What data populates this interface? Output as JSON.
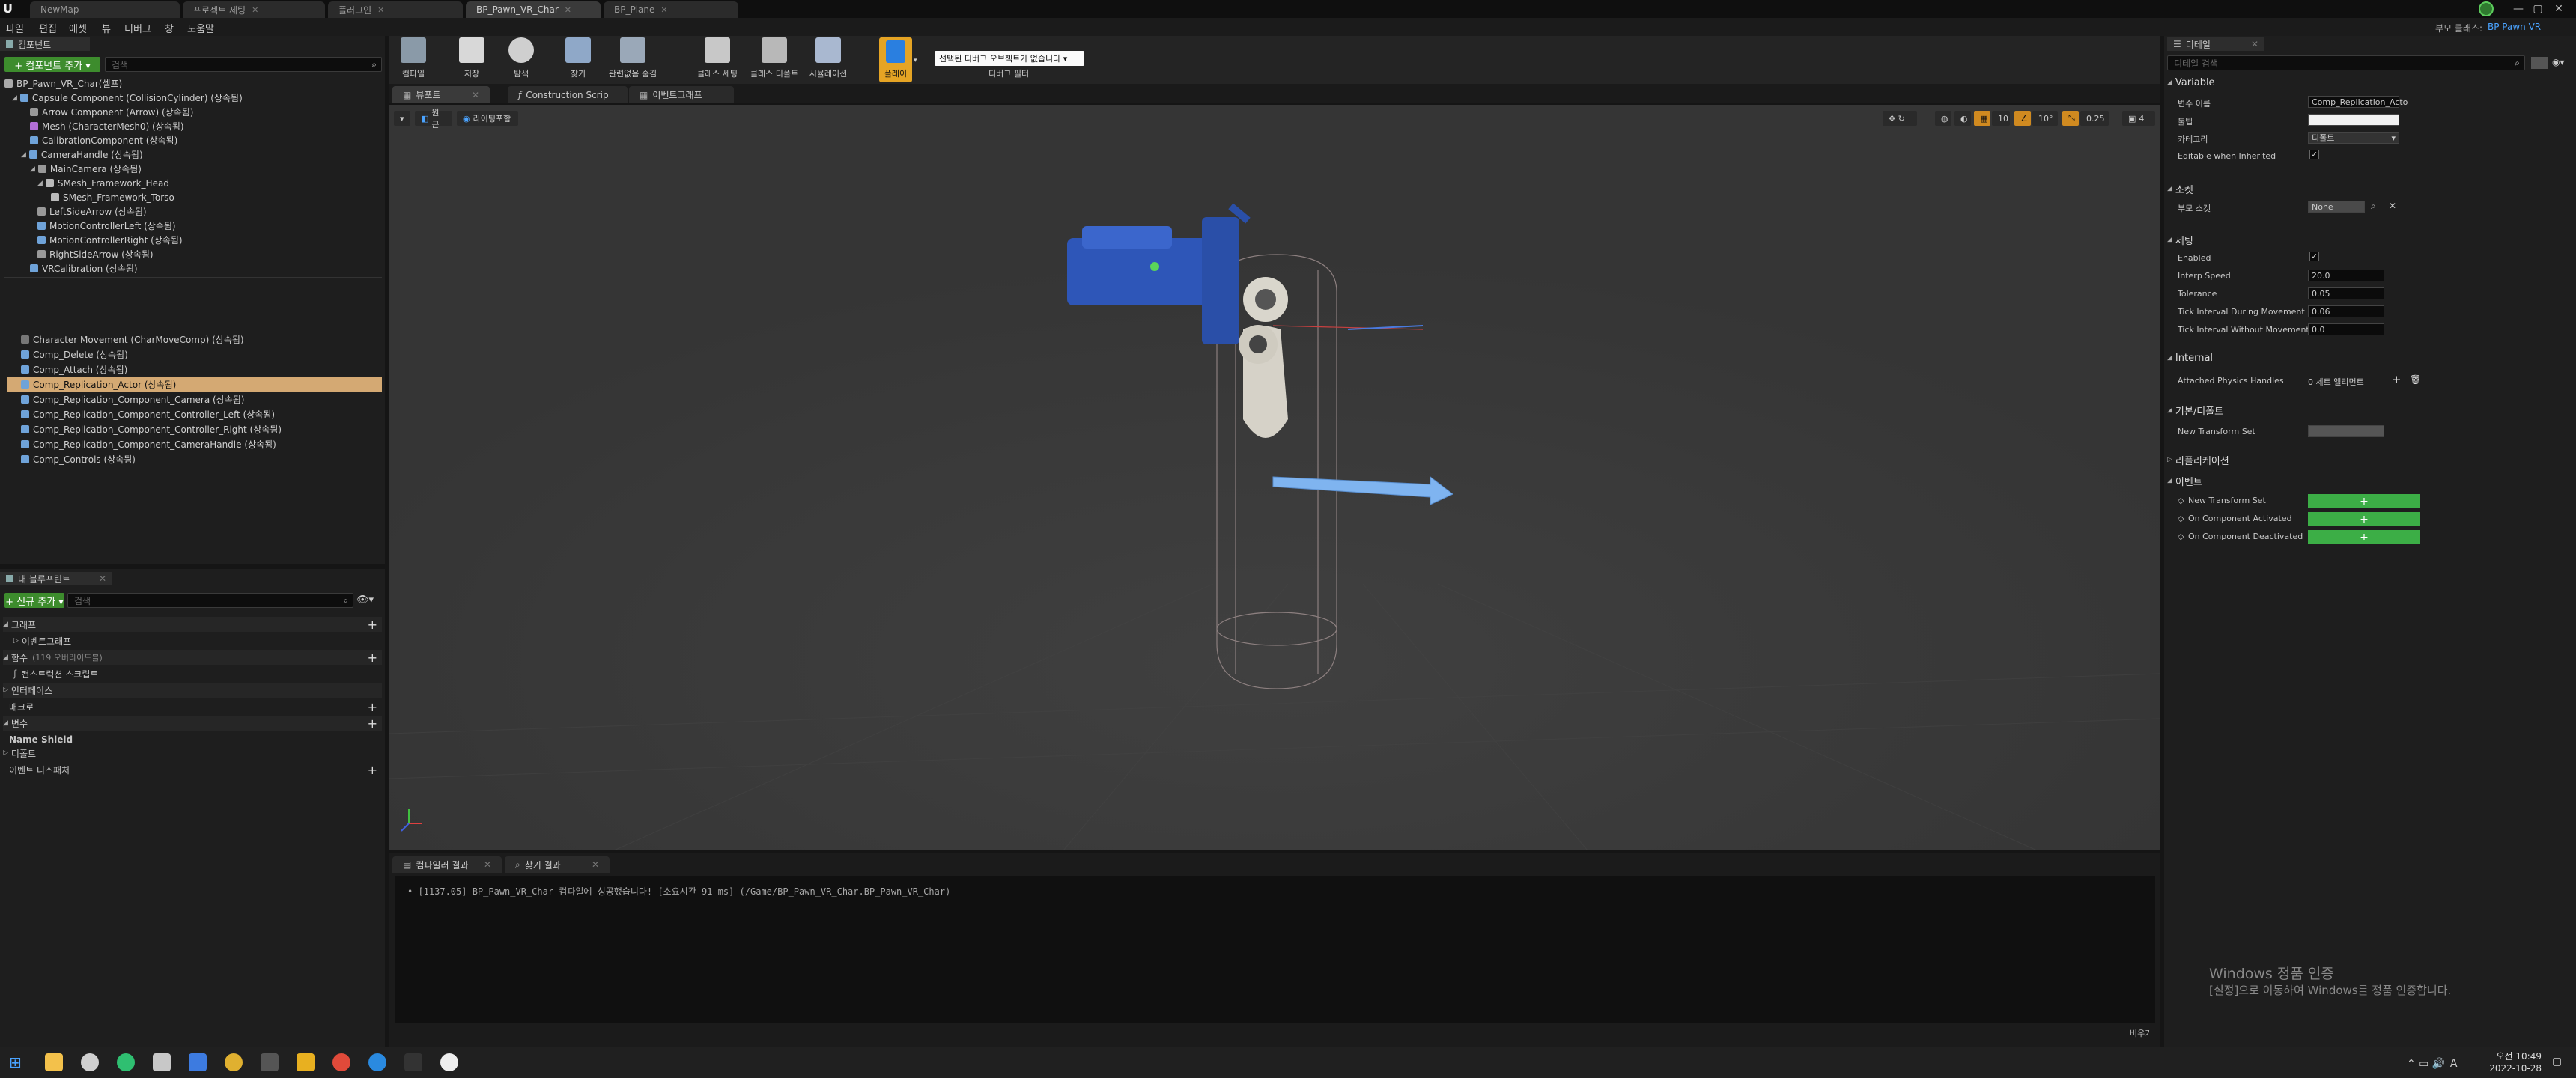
{
  "doc_tabs": [
    "NewMap",
    "프로젝트 세팅",
    "플러그인",
    "BP_Pawn_VR_Char",
    "BP_Plane"
  ],
  "window_controls": {
    "minimize": "—",
    "maximize": "▢",
    "close": "✕"
  },
  "menu": [
    "파일",
    "편집",
    "애셋",
    "뷰",
    "디버그",
    "창",
    "도움말"
  ],
  "top_right": {
    "parent_class_label": "부모 클래스:",
    "parent_class": "BP Pawn VR"
  },
  "components": {
    "tab": "컴포넌트",
    "add_button": "+ 컴포넌트 추가 ▾",
    "search_placeholder": "검색",
    "root": "BP_Pawn_VR_Char(셀프)",
    "items": [
      "Capsule Component (CollisionCylinder) (상속됨)",
      "Arrow Component (Arrow) (상속됨)",
      "Mesh (CharacterMesh0) (상속됨)",
      "CalibrationComponent (상속됨)",
      "CameraHandle (상속됨)",
      "MainCamera (상속됨)",
      "SMesh_Framework_Head",
      "SMesh_Framework_Torso",
      "LeftSideArrow (상속됨)",
      "MotionControllerLeft (상속됨)",
      "MotionControllerRight (상속됨)",
      "RightSideArrow (상속됨)",
      "VRCalibration (상속됨)",
      "Character Movement (CharMoveComp) (상속됨)",
      "Comp_Delete (상속됨)",
      "Comp_Attach (상속됨)",
      "Comp_Replication_Actor (상속됨)",
      "Comp_Replication_Component_Camera (상속됨)",
      "Comp_Replication_Component_Controller_Left (상속됨)",
      "Comp_Replication_Component_Controller_Right (상속됨)",
      "Comp_Replication_Component_CameraHandle (상속됨)",
      "Comp_Controls (상속됨)"
    ]
  },
  "my_blueprint": {
    "tab": "내 블루프린트",
    "add_button": "+ 신규 추가 ▾",
    "search_placeholder": "검색",
    "graph": "그래프",
    "event_graph": "이벤트그래프",
    "functions": "함수",
    "functions_count": "(119 오버라이드블)",
    "construction": "컨스트럭션 스크립트",
    "interfaces": "인터페이스",
    "macros": "매크로",
    "variables": "변수",
    "name_shield": "Name Shield",
    "defaults": "디폴트",
    "dispatchers": "이벤트 디스패처"
  },
  "toolbar": {
    "tools": [
      "컴파일",
      "저장",
      "탐색",
      "찾기",
      "관련없음 숨김",
      "클래스 세팅",
      "클래스 디폴트",
      "시뮬레이션",
      "플레이"
    ],
    "debug_dropdown": "선택된 디버그 오브젝트가 없습니다 ▾",
    "debug_label": "디버그 필터"
  },
  "editor_tabs": [
    "뷰포트",
    "Construction Scrip",
    "이벤트그래프"
  ],
  "viewport": {
    "perspective": "원근",
    "lit": "라이팅포함",
    "snap_grid": "10",
    "snap_rot": "10°",
    "snap_scale": "0.25",
    "cam_speed": "4"
  },
  "output_tabs": [
    "컴파일러 결과",
    "찾기 결과"
  ],
  "compile_message": "• [1137.05] BP_Pawn_VR_Char 컴파일에 성공했습니다! [소요시간 91 ms] (/Game/BP_Pawn_VR_Char.BP_Pawn_VR_Char)",
  "clear_label": "비우기",
  "details": {
    "tab": "디테일",
    "search_placeholder": "디테일 검색",
    "sections": {
      "variable": "Variable",
      "socket": "소켓",
      "settings": "세팅",
      "internal": "Internal",
      "defaults": "기본/디폴트",
      "replication": "리플리케이션",
      "events": "이벤트"
    },
    "var_name_label": "변수 이름",
    "var_name": "Comp_Replication_Acto",
    "tooltip_label": "툴팁",
    "category_label": "카테고리",
    "category": "디폴트",
    "editable_label": "Editable when Inherited",
    "parent_socket_label": "부모 소켓",
    "parent_socket": "None",
    "enabled_label": "Enabled",
    "interp_label": "Interp Speed",
    "interp": "20.0",
    "tolerance_label": "Tolerance",
    "tolerance": "0.05",
    "tick_move_label": "Tick Interval During Movement",
    "tick_move": "0.06",
    "tick_nomove_label": "Tick Interval Without Movement",
    "tick_nomove": "0.0",
    "attached_label": "Attached Physics Handles",
    "attached": "0 세트 엘리먼트",
    "new_transform_label": "New Transform Set",
    "events": [
      "New Transform Set",
      "On Component Activated",
      "On Component Deactivated"
    ]
  },
  "windows_watermark": {
    "title": "Windows 정품 인증",
    "subtitle": "[설정]으로 이동하여 Windows를 정품 인증합니다."
  },
  "taskbar": {
    "time": "오전 10:49",
    "date": "2022-10-28"
  }
}
